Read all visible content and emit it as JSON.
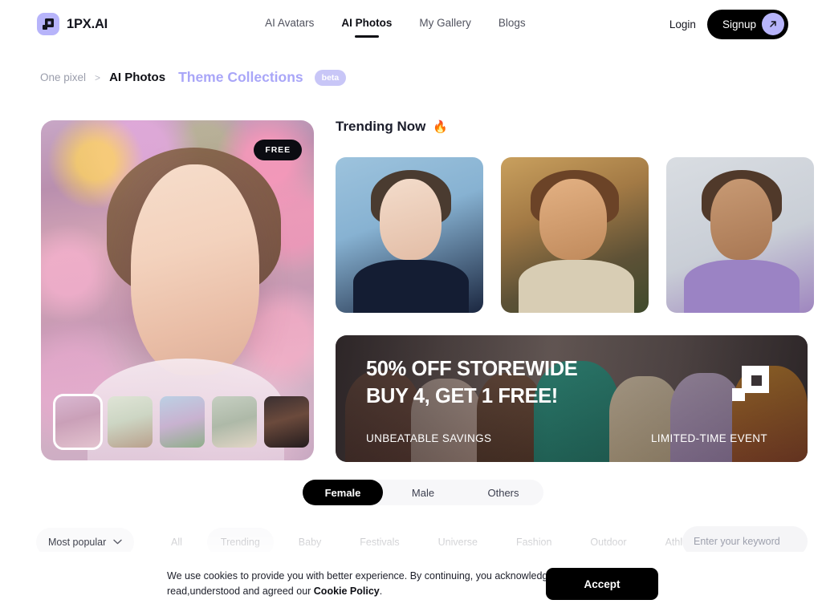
{
  "header": {
    "brand_name": "1PX.AI",
    "logo_icon": "pixel-square-icon",
    "nav": [
      {
        "label": "AI Avatars",
        "active": false
      },
      {
        "label": "AI Photos",
        "active": true
      },
      {
        "label": "My Gallery",
        "active": false
      },
      {
        "label": "Blogs",
        "active": false
      }
    ],
    "login_label": "Login",
    "signup_label": "Signup",
    "signup_icon": "arrow-up-right-icon"
  },
  "breadcrumb": {
    "root": "One pixel",
    "separator": ">",
    "current": "AI Photos",
    "theme_title": "Theme Collections",
    "beta_badge": "beta"
  },
  "hero": {
    "free_badge": "FREE",
    "thumbnails": [
      {
        "name": "thumb-flower-field",
        "selected": true
      },
      {
        "name": "thumb-white-lace",
        "selected": false
      },
      {
        "name": "thumb-ocean-portrait",
        "selected": false
      },
      {
        "name": "thumb-bridal-veil",
        "selected": false
      },
      {
        "name": "thumb-dark-leather",
        "selected": false
      }
    ]
  },
  "trending": {
    "title": "Trending Now",
    "flame_icon": "🔥",
    "cards": [
      {
        "name": "trending-card-blue-backdrop"
      },
      {
        "name": "trending-card-golden-hour"
      },
      {
        "name": "trending-card-lavender-shirt"
      }
    ]
  },
  "promo": {
    "line1": "50% OFF STOREWIDE",
    "line2": "BUY 4, GET 1 FREE!",
    "left_note": "UNBEATABLE SAVINGS",
    "right_note": "LIMITED-TIME EVENT",
    "watermark_icon": "pixel-square-watermark-icon"
  },
  "filters": {
    "gender": {
      "options": [
        {
          "label": "Female",
          "active": true
        },
        {
          "label": "Male",
          "active": false
        },
        {
          "label": "Others",
          "active": false
        }
      ]
    },
    "sort": {
      "selected": "Most popular",
      "chevron_icon": "chevron-down-icon"
    },
    "chips": [
      {
        "label": "All",
        "active": false
      },
      {
        "label": "Trending",
        "active": true
      },
      {
        "label": "Baby",
        "active": false
      },
      {
        "label": "Festivals",
        "active": false
      },
      {
        "label": "Universe",
        "active": false
      },
      {
        "label": "Fashion",
        "active": false
      },
      {
        "label": "Outdoor",
        "active": false
      },
      {
        "label": "Athletic",
        "active": false
      }
    ],
    "search": {
      "placeholder": "Enter your keyword",
      "value": "",
      "icon": "search-icon"
    }
  },
  "cookie": {
    "text_part1": "We use cookies to provide you with better experience. By continuing, you acknowledge that you have read,understood and agreed our ",
    "policy_link": "Cookie Policy",
    "text_part2": ".",
    "accept_label": "Accept"
  },
  "colors": {
    "accent_lavender": "#b7b4fa",
    "theme_title": "#a9a6f8",
    "black": "#000000",
    "flame_orange": "#ff5a33"
  }
}
